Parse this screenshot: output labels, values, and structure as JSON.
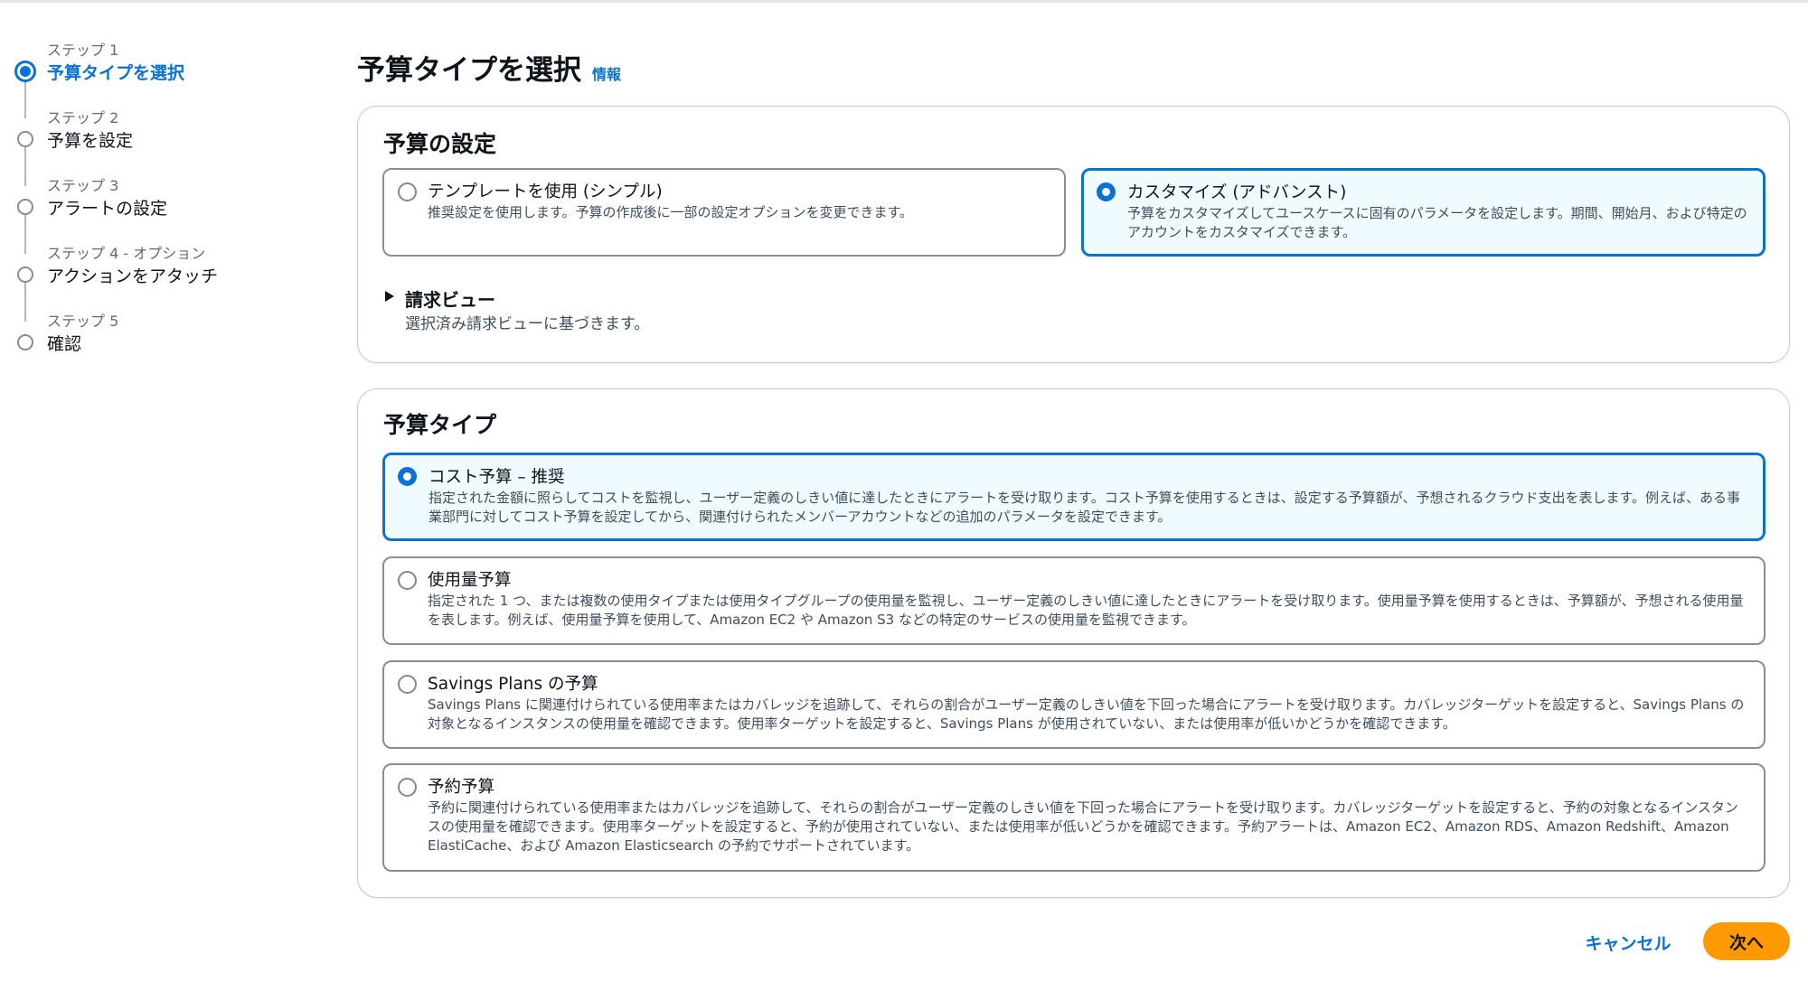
{
  "steps": [
    {
      "num": "ステップ 1",
      "label": "予算タイプを選択",
      "active": true
    },
    {
      "num": "ステップ 2",
      "label": "予算を設定",
      "active": false
    },
    {
      "num": "ステップ 3",
      "label": "アラートの設定",
      "active": false
    },
    {
      "num": "ステップ 4 - オプション",
      "label": "アクションをアタッチ",
      "active": false
    },
    {
      "num": "ステップ 5",
      "label": "確認",
      "active": false
    }
  ],
  "header": {
    "title": "予算タイプを選択",
    "info": "情報"
  },
  "budget_settings": {
    "title": "予算の設定",
    "options": [
      {
        "title": "テンプレートを使用 (シンプル)",
        "desc": "推奨設定を使用します。予算の作成後に一部の設定オプションを変更できます。",
        "selected": false
      },
      {
        "title": "カスタマイズ (アドバンスト)",
        "desc": "予算をカスタマイズしてユースケースに固有のパラメータを設定します。期間、開始月、および特定のアカウントをカスタマイズできます。",
        "selected": true
      }
    ],
    "billing_view": {
      "title": "請求ビュー",
      "desc": "選択済み請求ビューに基づきます。"
    }
  },
  "budget_types": {
    "title": "予算タイプ",
    "options": [
      {
        "title": "コスト予算 – 推奨",
        "desc": "指定された金額に照らしてコストを監視し、ユーザー定義のしきい値に達したときにアラートを受け取ります。コスト予算を使用するときは、設定する予算額が、予想されるクラウド支出を表します。例えば、ある事業部門に対してコスト予算を設定してから、関連付けられたメンバーアカウントなどの追加のパラメータを設定できます。",
        "selected": true
      },
      {
        "title": "使用量予算",
        "desc": "指定された 1 つ、または複数の使用タイプまたは使用タイプグループの使用量を監視し、ユーザー定義のしきい値に達したときにアラートを受け取ります。使用量予算を使用するときは、予算額が、予想される使用量を表します。例えば、使用量予算を使用して、Amazon EC2 や Amazon S3 などの特定のサービスの使用量を監視できます。",
        "selected": false
      },
      {
        "title": "Savings Plans の予算",
        "desc": "Savings Plans に関連付けられている使用率またはカバレッジを追跡して、それらの割合がユーザー定義のしきい値を下回った場合にアラートを受け取ります。カバレッジターゲットを設定すると、Savings Plans の対象となるインスタンスの使用量を確認できます。使用率ターゲットを設定すると、Savings Plans が使用されていない、または使用率が低いかどうかを確認できます。",
        "selected": false
      },
      {
        "title": "予約予算",
        "desc": "予約に関連付けられている使用率またはカバレッジを追跡して、それらの割合がユーザー定義のしきい値を下回った場合にアラートを受け取ります。カバレッジターゲットを設定すると、予約の対象となるインスタンスの使用量を確認できます。使用率ターゲットを設定すると、予約が使用されていない、または使用率が低いどうかを確認できます。予約アラートは、Amazon EC2、Amazon RDS、Amazon Redshift、Amazon ElastiCache、および Amazon Elasticsearch の予約でサポートされています。",
        "selected": false
      }
    ]
  },
  "footer": {
    "cancel": "キャンセル",
    "next": "次へ"
  }
}
